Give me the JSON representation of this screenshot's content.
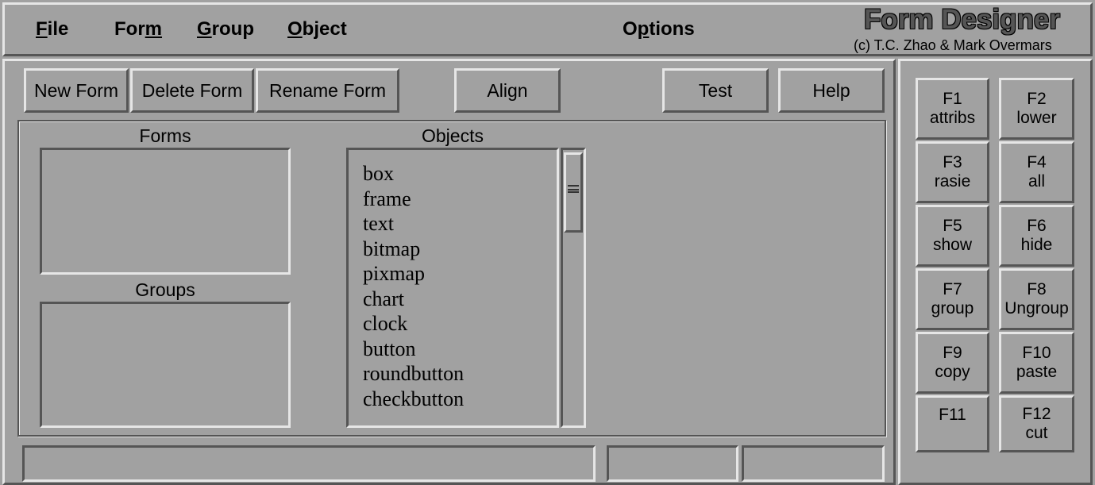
{
  "menu": {
    "file": {
      "hot": "F",
      "rest": "ile"
    },
    "form": {
      "pre": "For",
      "hot": "m"
    },
    "group": {
      "hot": "G",
      "rest": "roup"
    },
    "object": {
      "hot": "O",
      "rest": "bject"
    },
    "options": {
      "pre": "O",
      "hot": "p",
      "rest": "tions"
    }
  },
  "branding": {
    "title": "Form Designer",
    "credit": "(c) T.C. Zhao & Mark Overmars"
  },
  "toolbar": {
    "new_form": "New Form",
    "delete_form": "Delete Form",
    "rename_form": "Rename Form",
    "align": "Align",
    "test": "Test",
    "help": "Help"
  },
  "panels": {
    "forms_label": "Forms",
    "groups_label": "Groups",
    "objects_label": "Objects"
  },
  "objects": [
    "box",
    "frame",
    "text",
    "bitmap",
    "pixmap",
    "chart",
    "clock",
    "button",
    "roundbutton",
    "checkbutton"
  ],
  "fkeys": [
    {
      "key": "F1",
      "action": "attribs"
    },
    {
      "key": "F2",
      "action": "lower"
    },
    {
      "key": "F3",
      "action": "rasie"
    },
    {
      "key": "F4",
      "action": "all"
    },
    {
      "key": "F5",
      "action": "show"
    },
    {
      "key": "F6",
      "action": "hide"
    },
    {
      "key": "F7",
      "action": "group"
    },
    {
      "key": "F8",
      "action": "Ungroup"
    },
    {
      "key": "F9",
      "action": "copy"
    },
    {
      "key": "F10",
      "action": "paste"
    },
    {
      "key": "F11",
      "action": ""
    },
    {
      "key": "F12",
      "action": "cut"
    }
  ]
}
